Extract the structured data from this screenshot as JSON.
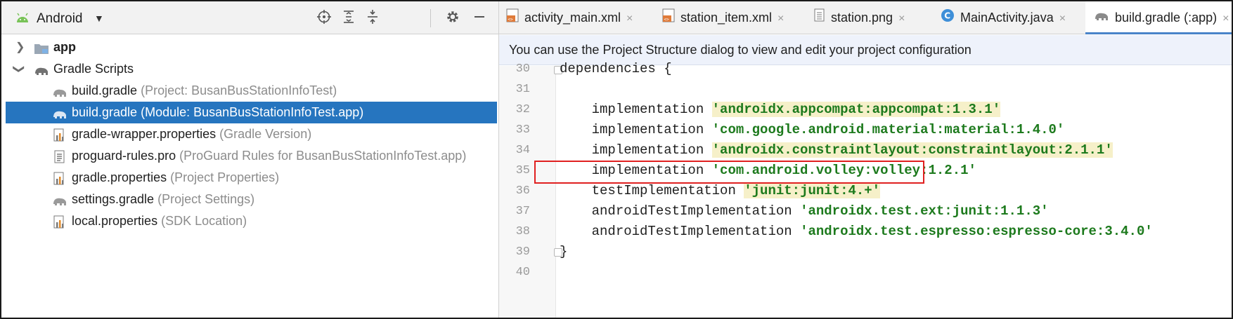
{
  "project_panel": {
    "view_label": "Android",
    "toolbar_icons": [
      "crosshair-icon",
      "expand-all-icon",
      "collapse-all-icon",
      "gear-icon",
      "minimize-icon"
    ],
    "tree": [
      {
        "name": "app",
        "hint": "",
        "icon": "folder-icon",
        "bold": true
      },
      {
        "name": "Gradle Scripts",
        "hint": "",
        "icon": "gradle-elephant-icon",
        "bold": false
      },
      {
        "name": "build.gradle",
        "hint": "(Project: BusanBusStationInfoTest)",
        "icon": "gradle-elephant-icon"
      },
      {
        "name": "build.gradle",
        "hint": "(Module: BusanBusStationInfoTest.app)",
        "icon": "gradle-elephant-icon"
      },
      {
        "name": "gradle-wrapper.properties",
        "hint": "(Gradle Version)",
        "icon": "properties-icon"
      },
      {
        "name": "proguard-rules.pro",
        "hint": "(ProGuard Rules for BusanBusStationInfoTest.app)",
        "icon": "text-file-icon"
      },
      {
        "name": "gradle.properties",
        "hint": "(Project Properties)",
        "icon": "properties-icon"
      },
      {
        "name": "settings.gradle",
        "hint": "(Project Settings)",
        "icon": "gradle-elephant-icon"
      },
      {
        "name": "local.properties",
        "hint": "(SDK Location)",
        "icon": "properties-icon"
      }
    ]
  },
  "tabs": [
    {
      "label": "activity_main.xml",
      "close": "×"
    },
    {
      "label": "station_item.xml",
      "close": "×"
    },
    {
      "label": "station.png",
      "close": "×"
    },
    {
      "label": "MainActivity.java",
      "close": "×"
    },
    {
      "label": "build.gradle (:app)",
      "close": "×"
    }
  ],
  "banner": "You can use the Project Structure dialog to view and edit your project configuration",
  "code": {
    "line_numbers": [
      "30",
      "31",
      "32",
      "33",
      "34",
      "35",
      "36",
      "37",
      "38",
      "39",
      "40"
    ],
    "lines": [
      {
        "kw": "dependencies {",
        "str": ""
      },
      {
        "kw": "",
        "str": ""
      },
      {
        "kw": "    implementation ",
        "str": "'androidx.appcompat:appcompat:1.3.1'"
      },
      {
        "kw": "    implementation ",
        "str": "'com.google.android.material:material:1.4.0'"
      },
      {
        "kw": "    implementation ",
        "str": "'androidx.constraintlayout:constraintlayout:2.1.1'"
      },
      {
        "kw": "    implementation ",
        "str": "'com.android.volley:volley:1.2.1'"
      },
      {
        "kw": "    testImplementation ",
        "str": "'junit:junit:4.+'"
      },
      {
        "kw": "    androidTestImplementation ",
        "str": "'androidx.test.ext:junit:1.1.3'"
      },
      {
        "kw": "    androidTestImplementation ",
        "str": "'androidx.test.espresso:espresso-core:3.4.0'"
      },
      {
        "kw": "}",
        "str": ""
      },
      {
        "kw": "",
        "str": ""
      }
    ]
  },
  "colors": {
    "selection": "#2675bf",
    "string": "#1d7a1d",
    "string_highlight": "#f6f0c9",
    "annotation_box": "#e02020"
  }
}
